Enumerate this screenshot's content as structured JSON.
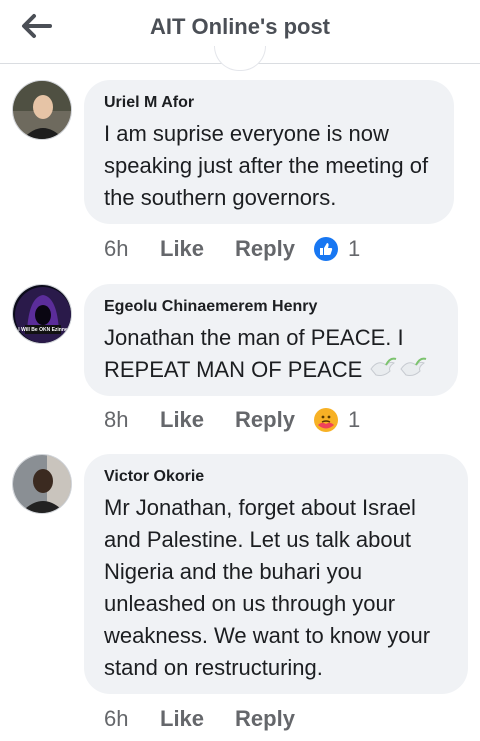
{
  "header": {
    "title": "AIT Online's post"
  },
  "comments": [
    {
      "author": "Uriel M Afor",
      "text": "I am suprise everyone is now speaking just after the meeting of the southern governors.",
      "time": "6h",
      "like_label": "Like",
      "reply_label": "Reply",
      "reaction": {
        "icon": "like-reaction-icon",
        "count": "1"
      }
    },
    {
      "author": "Egeolu Chinaemerem Henry",
      "text": "Jonathan the man of PEACE. I REPEAT MAN OF PEACE",
      "emoji": "dove-emoji",
      "avatar_text": "I Will Be OKN Ezinne",
      "time": "8h",
      "like_label": "Like",
      "reply_label": "Reply",
      "reaction": {
        "icon": "care-reaction-icon",
        "count": "1"
      }
    },
    {
      "author": "Victor Okorie",
      "text": "Mr Jonathan, forget about Israel and Palestine. Let us talk about Nigeria and the buhari you unleashed on us through your weakness. We want to know your stand on restructuring.",
      "time": "6h",
      "like_label": "Like",
      "reply_label": "Reply"
    }
  ],
  "colors": {
    "bubble": "#f0f2f5",
    "like_blue": "#1877f2",
    "meta_gray": "#65676b"
  }
}
